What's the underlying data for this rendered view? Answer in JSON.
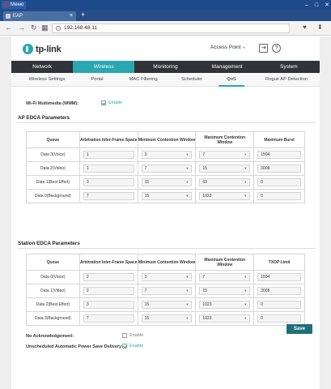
{
  "browser": {
    "menu_label": "Меню",
    "tab_title": "EAP",
    "url": "192.168.48.11"
  },
  "header": {
    "logo_text": "tp-link",
    "mode_label": "Access Point"
  },
  "main_nav": [
    "Network",
    "Wireless",
    "Monitoring",
    "Management",
    "System"
  ],
  "sub_nav": [
    "Wireless Settings",
    "Portal",
    "MAC Filtering",
    "Scheduler",
    "QoS",
    "Rogue AP Detection"
  ],
  "wmm": {
    "label": "Wi-Fi Multimedia (WMM):",
    "check_label": "Enable"
  },
  "ap_edca": {
    "title": "AP EDCA Parameters",
    "headers": [
      "Queue",
      "Arbitration Inter-Frame Space",
      "Minimum Contention Window",
      "Maximum Contention Window",
      "Maximum Burst"
    ],
    "rows": [
      {
        "queue": "Data 3(Voice)",
        "aifs": "1",
        "cwmin": "3",
        "cwmax": "7",
        "burst": "1504"
      },
      {
        "queue": "Data 2(Video)",
        "aifs": "1",
        "cwmin": "7",
        "cwmax": "15",
        "burst": "3008"
      },
      {
        "queue": "Data 1(Best Effort)",
        "aifs": "3",
        "cwmin": "15",
        "cwmax": "63",
        "burst": "0"
      },
      {
        "queue": "Data 0(Background)",
        "aifs": "7",
        "cwmin": "15",
        "cwmax": "1023",
        "burst": "0"
      }
    ]
  },
  "station_edca": {
    "title": "Station EDCA Parameters",
    "headers": [
      "Queue",
      "Arbitration Inter-Frame Space",
      "Minimum Contention Window",
      "Maximum Contention Window",
      "TXOP Limit"
    ],
    "rows": [
      {
        "queue": "Data 0(Voice)",
        "aifs": "2",
        "cwmin": "3",
        "cwmax": "7",
        "burst": "1504"
      },
      {
        "queue": "Data 1(Video)",
        "aifs": "2",
        "cwmin": "7",
        "cwmax": "15",
        "burst": "3008"
      },
      {
        "queue": "Data 2(Best Effort)",
        "aifs": "3",
        "cwmin": "15",
        "cwmax": "1023",
        "burst": "0"
      },
      {
        "queue": "Data 3(Background)",
        "aifs": "7",
        "cwmin": "15",
        "cwmax": "1023",
        "burst": "0"
      }
    ]
  },
  "no_ack": {
    "label": "No Acknowledgement:",
    "check_label": "Enable"
  },
  "apsd": {
    "label": "Unscheduled Automatic Power Save Delivery:",
    "check_label": "Enable"
  },
  "save_label": "Save"
}
